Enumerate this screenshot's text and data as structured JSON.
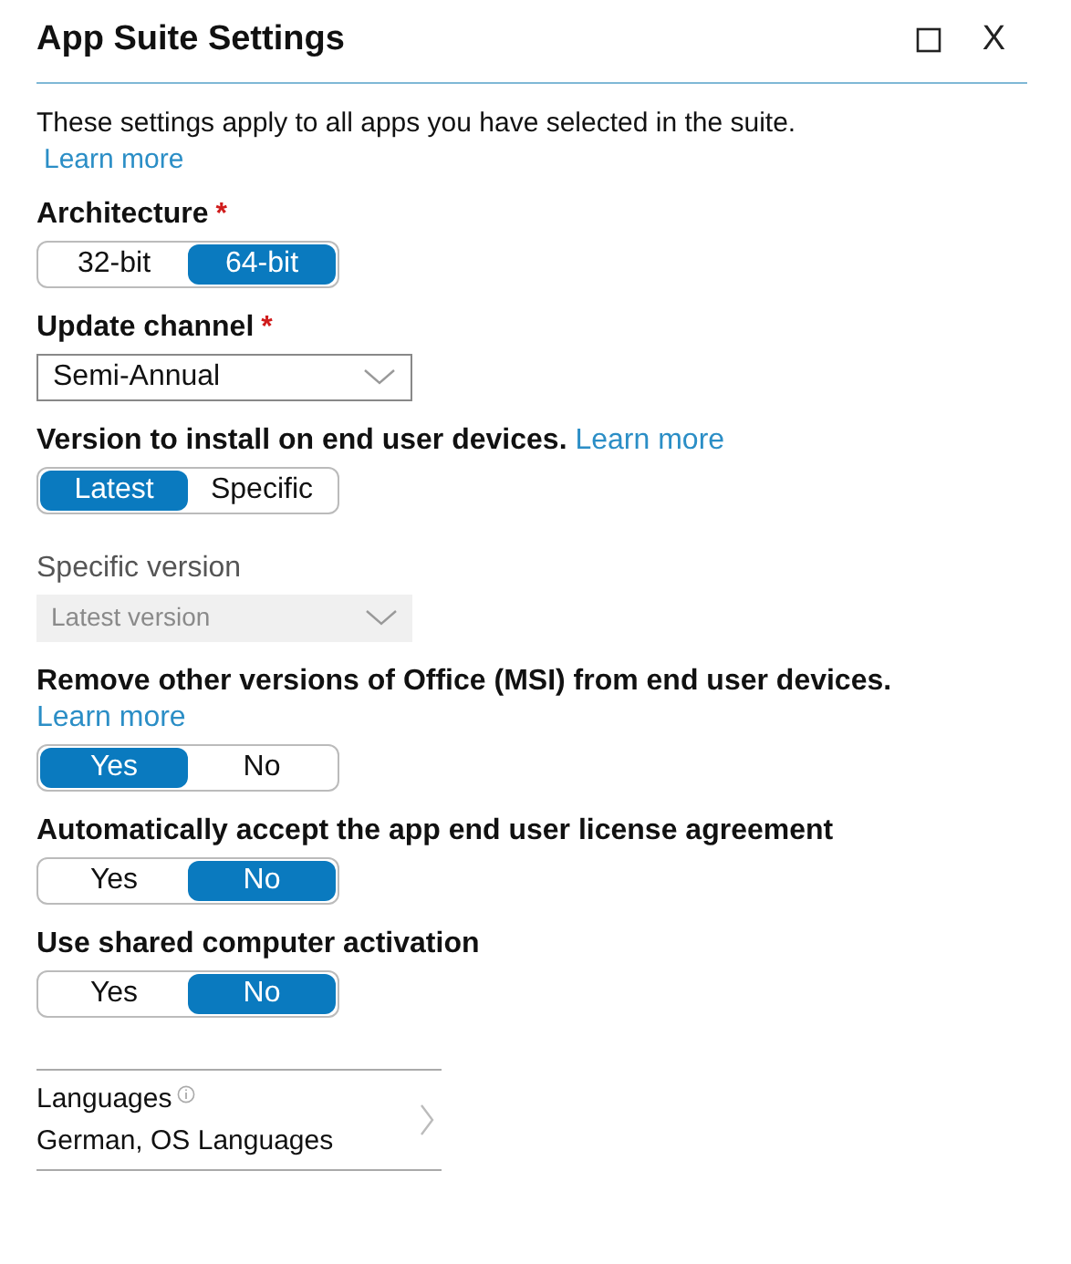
{
  "window": {
    "title": "App Suite Settings",
    "close": "X"
  },
  "intro": {
    "text": "These settings apply to all apps you have selected in the suite.",
    "link": "Learn more"
  },
  "fields": [
    {
      "kind": "toggle",
      "label": "Architecture",
      "required_mark": "*",
      "options": [
        {
          "label": "32-bit",
          "selected": false
        },
        {
          "label": "64-bit",
          "selected": true
        }
      ]
    },
    {
      "kind": "dropdown",
      "label": "Update channel",
      "required_mark": "*",
      "value": "Semi-Annual",
      "disabled": false
    },
    {
      "kind": "toggle",
      "label": "Version to install on end user devices.",
      "link": "Learn more",
      "options": [
        {
          "label": "Latest",
          "selected": true
        },
        {
          "label": "Specific",
          "selected": false
        }
      ]
    },
    {
      "kind": "dropdown",
      "label": "Specific version",
      "value": "Latest version",
      "disabled": true
    },
    {
      "kind": "toggle",
      "label": "Remove other versions of Office (MSI) from end user devices.",
      "link": "Learn more",
      "options": [
        {
          "label": "Yes",
          "selected": true
        },
        {
          "label": "No",
          "selected": false
        }
      ]
    },
    {
      "kind": "toggle",
      "label": "Automatically accept the app end user license agreement",
      "options": [
        {
          "label": "Yes",
          "selected": false
        },
        {
          "label": "No",
          "selected": true
        }
      ]
    },
    {
      "kind": "toggle",
      "label": "Use shared computer activation",
      "options": [
        {
          "label": "Yes",
          "selected": false
        },
        {
          "label": "No",
          "selected": true
        }
      ]
    }
  ],
  "languages": {
    "label": "Languages",
    "value": "German, OS Languages"
  }
}
